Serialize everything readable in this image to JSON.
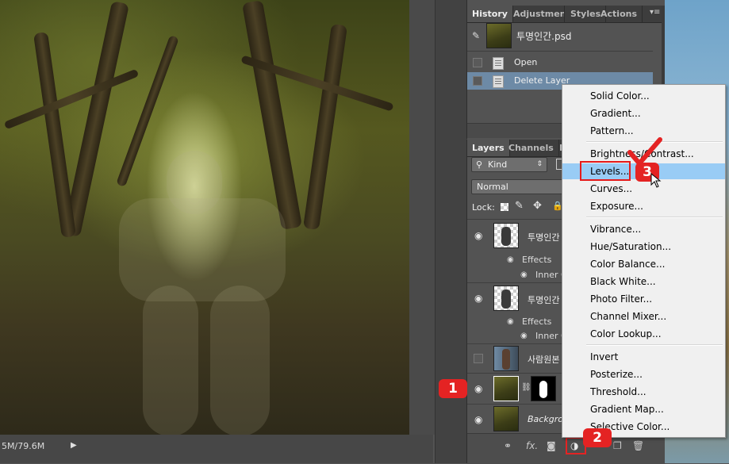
{
  "canvas": {
    "status_text": "5M/79.6M"
  },
  "history_panel": {
    "tabs": [
      "History",
      "Adjustments",
      "Styles",
      "Actions"
    ],
    "snapshot_name": "투명인간.psd",
    "states": [
      "Open",
      "Delete Layer"
    ]
  },
  "layers_panel": {
    "tabs": [
      "Layers",
      "Channels",
      "P"
    ],
    "filter_kind": "Kind",
    "blend_mode": "Normal",
    "lock_label": "Lock:",
    "layers": [
      {
        "name": "투명인간",
        "effects_label": "Effects",
        "effect": "Inner G"
      },
      {
        "name": "투명인간",
        "effects_label": "Effects",
        "effect": "Inner G"
      },
      {
        "name": "사람원본"
      },
      {
        "name": ""
      },
      {
        "name": "Backgrou"
      }
    ],
    "fx_label": "fx."
  },
  "adjustment_menu": {
    "items": [
      [
        "Solid Color...",
        "Gradient...",
        "Pattern..."
      ],
      [
        "Brightness/Contrast...",
        "Levels...",
        "Curves...",
        "Exposure..."
      ],
      [
        "Vibrance...",
        "Hue/Saturation...",
        "Color Balance...",
        "Black  White...",
        "Photo Filter...",
        "Channel Mixer...",
        "Color Lookup..."
      ],
      [
        "Invert",
        "Posterize...",
        "Threshold...",
        "Gradient Map...",
        "Selective Color..."
      ]
    ],
    "highlighted": "Levels..."
  },
  "annotations": {
    "step1": "1",
    "step2": "2",
    "step3": "3",
    "color": "#e42323"
  }
}
